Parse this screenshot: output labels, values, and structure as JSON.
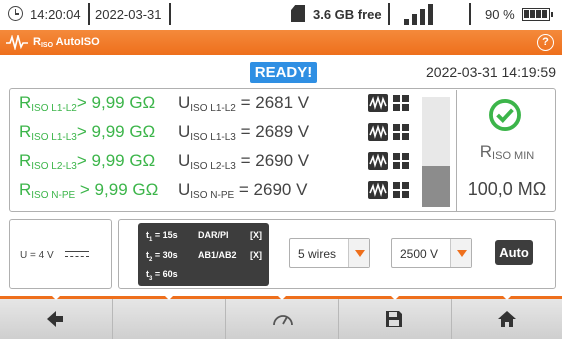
{
  "status_bar": {
    "time": "14:20:04",
    "date": "2022-03-31",
    "free_space": "3.6 GB free",
    "battery_percent": "90 %",
    "signal_bars": 4,
    "battery_level": 1.0
  },
  "title_bar": {
    "title_r": "R",
    "title_sub": "ISO",
    "title_rest": " AutoISO",
    "help": "?"
  },
  "status": {
    "ready": "READY!",
    "datetime": "2022-03-31 14:19:59"
  },
  "results": [
    {
      "r_sym": "R",
      "r_sub": "ISO L1-L2",
      "r_value": "> 9,99 GΩ",
      "u_sym": "U",
      "u_sub": "ISO L1-L2",
      "u_value": " = 2681 V"
    },
    {
      "r_sym": "R",
      "r_sub": "ISO L1-L3",
      "r_value": "> 9,99 GΩ",
      "u_sym": "U",
      "u_sub": "ISO L1-L3",
      "u_value": " = 2689 V"
    },
    {
      "r_sym": "R",
      "r_sub": "ISO L2-L3",
      "r_value": "> 9,99 GΩ",
      "u_sym": "U",
      "u_sub": "ISO L2-L3",
      "u_value": " = 2690 V"
    },
    {
      "r_sym": "R",
      "r_sub": "ISO N-PE",
      "r_value": " > 9,99 GΩ",
      "u_sym": "U",
      "u_sub": "ISO N-PE",
      "u_value": " = 2690 V"
    }
  ],
  "bar_level": 0.37,
  "limit": {
    "label_sym": "R",
    "label_sub": "ISO MIN",
    "value": "100,0 MΩ"
  },
  "settings": {
    "u_label": "U = 4 V",
    "times": [
      {
        "t_sym": "t",
        "t_sub": "1",
        "t_val": " = 15s",
        "extra": "DAR/PI",
        "flag": "[X]"
      },
      {
        "t_sym": "t",
        "t_sub": "2",
        "t_val": " = 30s",
        "extra": "AB1/AB2",
        "flag": "[X]"
      },
      {
        "t_sym": "t",
        "t_sub": "3",
        "t_val": " = 60s",
        "extra": "",
        "flag": ""
      }
    ],
    "wires": "5 wires",
    "voltage": "2500 V",
    "auto": "Auto"
  },
  "toolbar": {
    "icons": [
      "back-arrow-icon",
      "",
      "gauge-icon",
      "save-disk-icon",
      "home-icon"
    ]
  },
  "colors": {
    "accent": "#ee6f1c",
    "ok_green": "#3cb54a",
    "ready_blue": "#2f8fe3"
  }
}
